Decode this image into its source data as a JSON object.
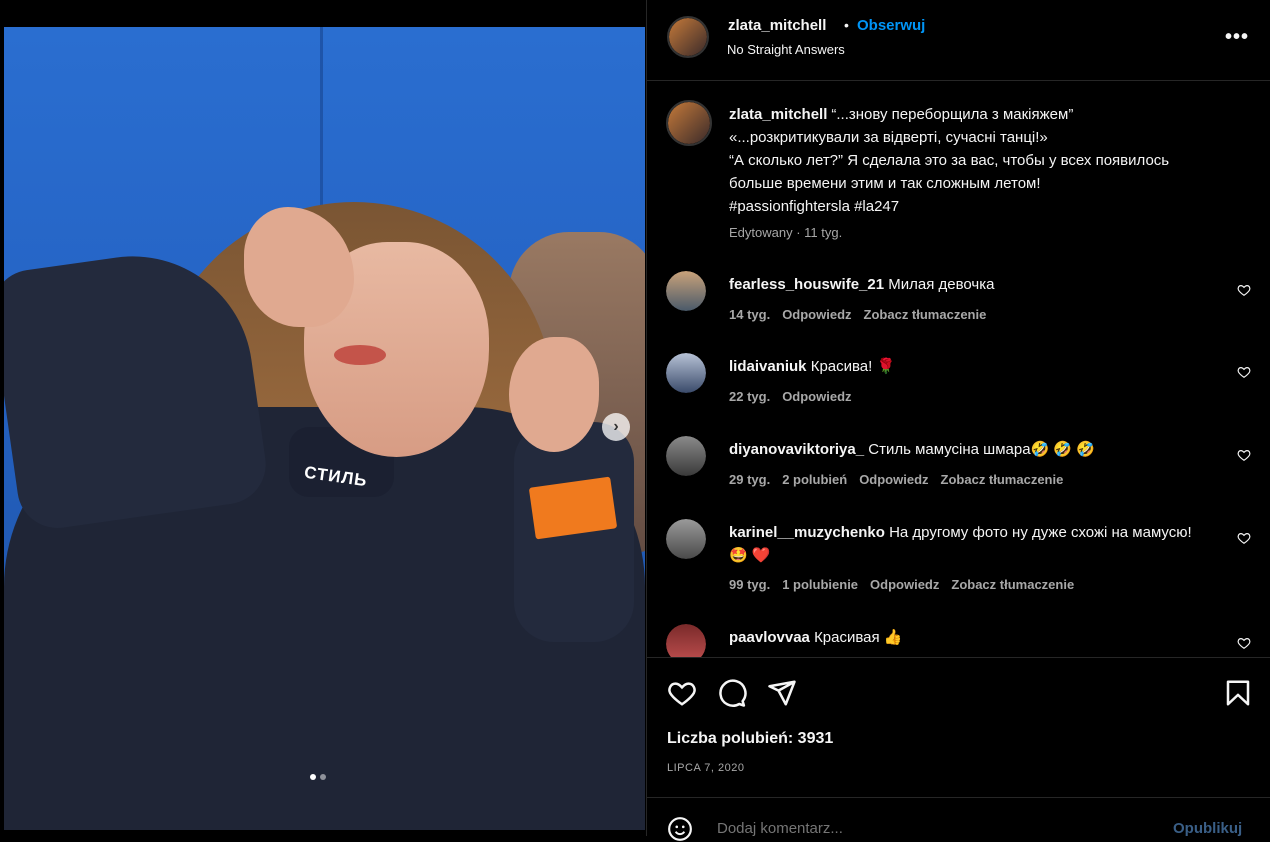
{
  "post": {
    "author": "zlata_mitchell",
    "follow_label": "Obserwuj",
    "subtitle": "No Straight Answers",
    "more_label": "•••",
    "image_collar_text": "СТИЛЬ",
    "carousel_dots": 2,
    "carousel_active": 0
  },
  "caption": {
    "username": "zlata_mitchell",
    "lines": [
      "“...знову переборщила з макіяжем”",
      "«...розкритикували за відверті, сучасні танці!»",
      "“А сколько лет?” Я сделала это за вас, чтобы у всех появилось",
      "больше времени этим и так сложным летом!",
      "#passionfightersla #la247"
    ],
    "meta": "Edytowany · 11 tyg."
  },
  "comments": [
    {
      "username": "fearless_houswife_21",
      "text": "Милая девочка",
      "time": "14 tyg.",
      "likes": "",
      "reply": "Odpowiedz",
      "translate": "Zobacz tłumaczenie",
      "avatar_color": "#8a7a6a"
    },
    {
      "username": "lidaivaniuk",
      "text": "Красива! 🌹",
      "time": "22 tyg.",
      "likes": "",
      "reply": "Odpowiedz",
      "translate": "",
      "avatar_color": "#5a6b8a"
    },
    {
      "username": "diyanovaviktoriya_",
      "text": "Стиль мамусіна шмара🤣 🤣 🤣",
      "time": "29 tyg.",
      "likes": "2 polubień",
      "reply": "Odpowiedz",
      "translate": "Zobacz tłumaczenie",
      "avatar_color": "#6b6b6b"
    },
    {
      "username": "karinel__muzychenko",
      "text": "На другому фото ну дуже схожі на мамусю! 🤩 ❤️",
      "time": "99 tyg.",
      "likes": "1 polubienie",
      "reply": "Odpowiedz",
      "translate": "Zobacz tłumaczenie",
      "avatar_color": "#7a7a7a"
    },
    {
      "username": "paavlovvaa",
      "text": "Красивая 👍",
      "time": "",
      "likes": "",
      "reply": "",
      "translate": "",
      "avatar_color": "#9a3a3a"
    }
  ],
  "actions": {
    "likes_text": "Liczba polubień: 3931",
    "date_text": "LIPCA 7, 2020"
  },
  "add_comment": {
    "placeholder": "Dodaj komentarz...",
    "publish_label": "Opublikuj"
  },
  "colors": {
    "accent": "#0095f6",
    "background": "#000000",
    "muted": "#a8a8a8"
  },
  "icons": [
    "heart-icon",
    "comment-icon",
    "share-icon",
    "bookmark-icon",
    "emoji-icon",
    "chevron-right-icon",
    "more-icon"
  ]
}
